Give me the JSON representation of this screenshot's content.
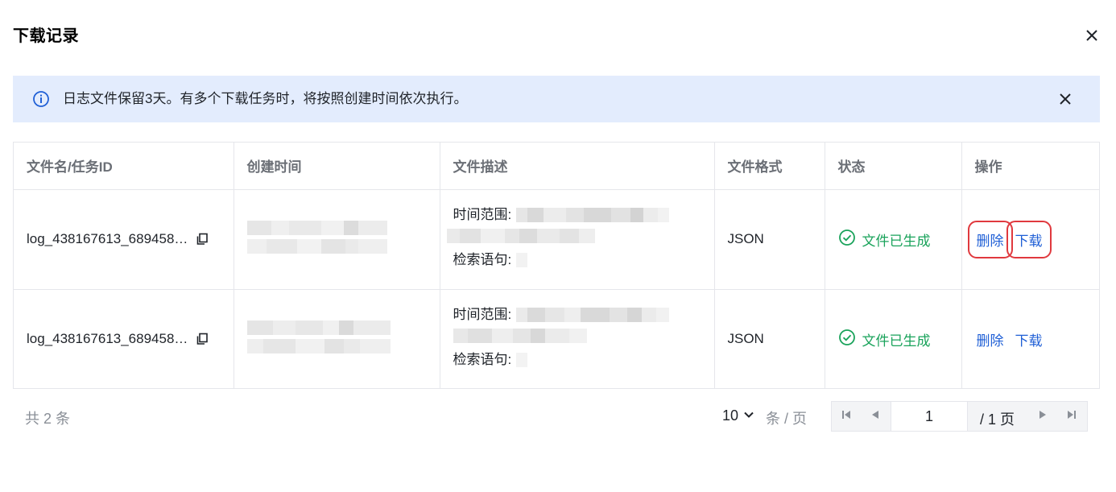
{
  "dialog": {
    "title": "下载记录"
  },
  "notice": {
    "text": "日志文件保留3天。有多个下载任务时，将按照创建时间依次执行。"
  },
  "table": {
    "columns": [
      "文件名/任务ID",
      "创建时间",
      "文件描述",
      "文件格式",
      "状态",
      "操作"
    ],
    "rows": [
      {
        "filename": "log_438167613_689458…",
        "time_range_label": "时间范围:",
        "query_label": "检索语句:",
        "format": "JSON",
        "status": "文件已生成",
        "delete_label": "删除",
        "download_label": "下载"
      },
      {
        "filename": "log_438167613_689458…",
        "time_range_label": "时间范围:",
        "query_label": "检索语句:",
        "format": "JSON",
        "status": "文件已生成",
        "delete_label": "删除",
        "download_label": "下载"
      }
    ]
  },
  "footer": {
    "total": "共 2 条",
    "page_size": "10",
    "page_size_unit": "条 / 页",
    "current_page": "1",
    "page_of": "/ 1 页"
  },
  "colors": {
    "accent": "#1f5fd6",
    "success": "#1aa35b",
    "highlight": "#e0393e",
    "notice_bg": "#e3ecfd"
  }
}
